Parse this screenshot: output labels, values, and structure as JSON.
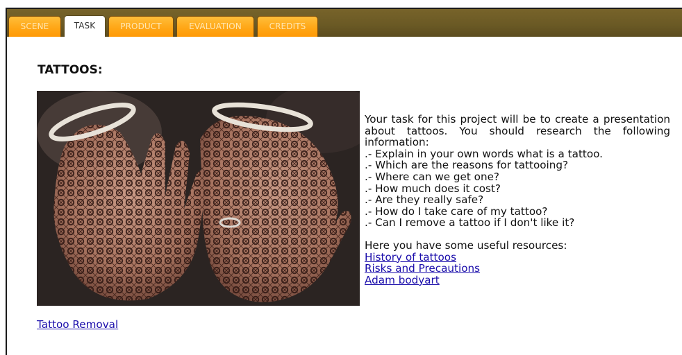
{
  "tabs": [
    {
      "label": "SCENE",
      "active": false
    },
    {
      "label": "TASK",
      "active": true
    },
    {
      "label": "PRODUCT",
      "active": false
    },
    {
      "label": "EVALUATION",
      "active": false
    },
    {
      "label": "CREDITS",
      "active": false
    }
  ],
  "page": {
    "title": "TATTOOS:",
    "intro": "Your task for this project will be to create a presentation about tattoos. You should research the following information:",
    "questions": [
      ".- Explain in your own words what is a tattoo.",
      ".- Which are the reasons for tattooing?",
      ".- Where can we get one?",
      ".- How much does it cost?",
      ".- Are they really safe?",
      ".- How do I take care of my tattoo?",
      ".- Can I remove a tattoo if I don't like it?"
    ],
    "resources_intro": "Here you have some useful resources:",
    "resources": [
      "History of tattoos",
      "Risks and Precautions",
      "Adam bodyart"
    ],
    "extra_link": "Tattoo Removal"
  },
  "colors": {
    "tab_orange": "#ffa514",
    "tab_bar": "#6b5a25",
    "link": "#1a0dab"
  }
}
